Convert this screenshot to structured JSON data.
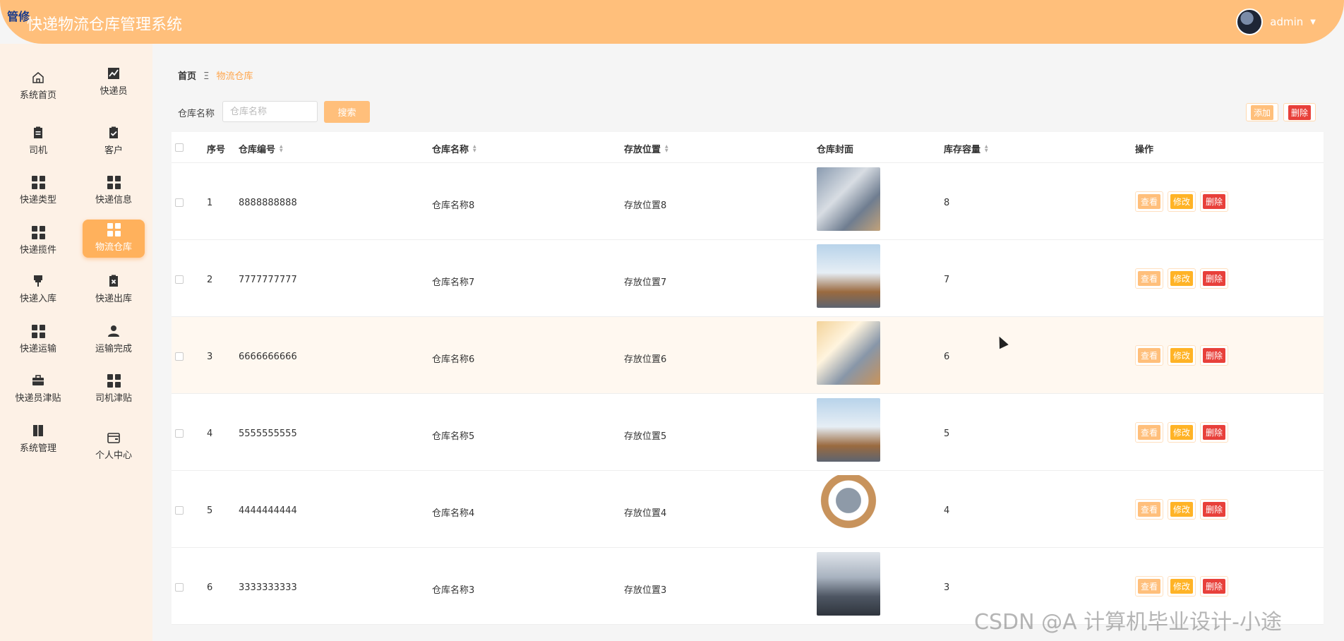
{
  "header": {
    "badge": "管修",
    "title": "快递物流仓库管理系统",
    "user": "admin",
    "color": "#ffbf7b"
  },
  "sidebar": {
    "items": [
      {
        "label": "系统首页",
        "icon": "home-icon"
      },
      {
        "label": "快递员",
        "icon": "chart-icon"
      },
      {
        "label": "司机",
        "icon": "clipboard-icon"
      },
      {
        "label": "客户",
        "icon": "clipboard-check-icon"
      },
      {
        "label": "快递类型",
        "icon": "grid-icon"
      },
      {
        "label": "快递信息",
        "icon": "grid-icon"
      },
      {
        "label": "快递揽件",
        "icon": "grid-icon"
      },
      {
        "label": "物流仓库",
        "icon": "grid-icon",
        "active": true
      },
      {
        "label": "快递入库",
        "icon": "pin-icon"
      },
      {
        "label": "快递出库",
        "icon": "clipboard-x-icon"
      },
      {
        "label": "快递运输",
        "icon": "grid-icon"
      },
      {
        "label": "运输完成",
        "icon": "user-icon"
      },
      {
        "label": "快递员津贴",
        "icon": "briefcase-icon"
      },
      {
        "label": "司机津贴",
        "icon": "grid-icon"
      },
      {
        "label": "系统管理",
        "icon": "book-icon"
      },
      {
        "label": "个人中心",
        "icon": "wallet-icon"
      }
    ]
  },
  "breadcrumb": {
    "home": "首页",
    "sep": "Ξ",
    "current": "物流仓库"
  },
  "search": {
    "label": "仓库名称",
    "placeholder": "仓库名称",
    "button": "搜索"
  },
  "actions": {
    "add": "添加",
    "delete": "删除"
  },
  "table": {
    "headers": {
      "index": "序号",
      "code": "仓库编号",
      "name": "仓库名称",
      "location": "存放位置",
      "cover": "仓库封面",
      "capacity": "库存容量",
      "ops": "操作"
    },
    "rows": [
      {
        "index": "1",
        "code": "8888888888",
        "name": "仓库名称8",
        "location": "存放位置8",
        "capacity": "8"
      },
      {
        "index": "2",
        "code": "7777777777",
        "name": "仓库名称7",
        "location": "存放位置7",
        "capacity": "7"
      },
      {
        "index": "3",
        "code": "6666666666",
        "name": "仓库名称6",
        "location": "存放位置6",
        "capacity": "6"
      },
      {
        "index": "4",
        "code": "5555555555",
        "name": "仓库名称5",
        "location": "存放位置5",
        "capacity": "5"
      },
      {
        "index": "5",
        "code": "4444444444",
        "name": "仓库名称4",
        "location": "存放位置4",
        "capacity": "4"
      },
      {
        "index": "6",
        "code": "3333333333",
        "name": "仓库名称3",
        "location": "存放位置3",
        "capacity": "3"
      }
    ],
    "op_labels": {
      "view": "查看",
      "edit": "修改",
      "delete": "删除"
    }
  },
  "watermark": "CSDN @A 计算机毕业设计-小途"
}
